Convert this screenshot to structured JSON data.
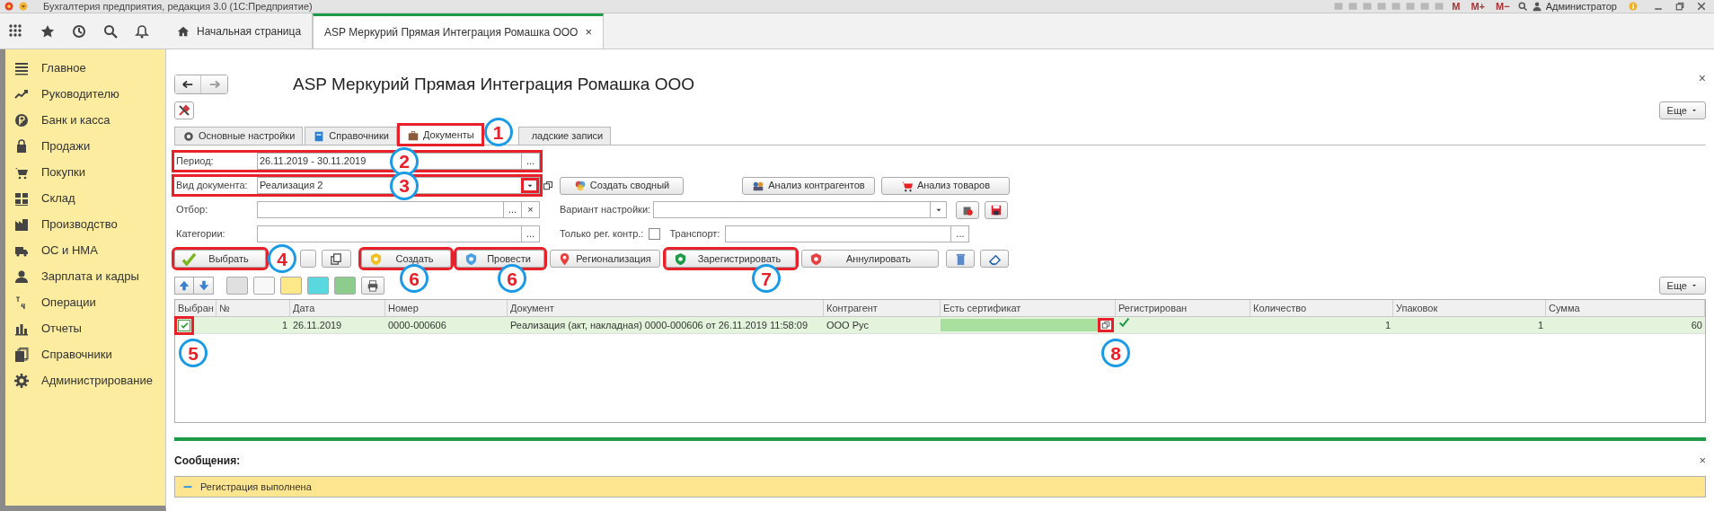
{
  "window": {
    "title": "Бухгалтерия предприятия, редакция 3.0  (1С:Предприятие)",
    "memory_buttons": [
      "M",
      "M+",
      "M−"
    ],
    "user": "Администратор"
  },
  "app_tabs": [
    {
      "label": "Начальная страница",
      "selected": false
    },
    {
      "label": "ASP Меркурий Прямая Интеграция Ромашка ООО",
      "selected": true,
      "close": "×"
    }
  ],
  "sidebar": {
    "items": [
      {
        "label": "Главное"
      },
      {
        "label": "Руководителю"
      },
      {
        "label": "Банк и касса"
      },
      {
        "label": "Продажи"
      },
      {
        "label": "Покупки"
      },
      {
        "label": "Склад"
      },
      {
        "label": "Производство"
      },
      {
        "label": "ОС и НМА"
      },
      {
        "label": "Зарплата и кадры"
      },
      {
        "label": "Операции"
      },
      {
        "label": "Отчеты"
      },
      {
        "label": "Справочники"
      },
      {
        "label": "Администрирование"
      }
    ]
  },
  "form": {
    "title": "ASP Меркурий Прямая Интеграция Ромашка ООО",
    "close": "×",
    "more_button": "Еще",
    "tabs": [
      {
        "label": "Основные настройки",
        "selected": false,
        "highlighted": false
      },
      {
        "label": "Справочники",
        "selected": false,
        "highlighted": false
      },
      {
        "label": "Документы",
        "selected": true,
        "highlighted": true,
        "callout": "1"
      },
      {
        "label": "ладские записи",
        "selected": false,
        "highlighted": false
      }
    ],
    "fields": [
      {
        "label": "Период:",
        "value": "26.11.2019 - 30.11.2019",
        "highlighted": true,
        "callout": "2",
        "buttons": [
          {
            "kind": "text",
            "text": "..."
          }
        ]
      },
      {
        "label": "Вид документа:",
        "value": "Реализация 2",
        "highlighted": true,
        "callout": "3",
        "buttons": [
          {
            "kind": "dropdown",
            "highlighted": true
          },
          {
            "kind": "open"
          }
        ]
      },
      {
        "label": "Отбор:",
        "highlighted": false,
        "buttons": [
          {
            "kind": "text",
            "text": "..."
          },
          {
            "kind": "text",
            "text": "×"
          }
        ]
      },
      {
        "label": "Категории:",
        "highlighted": false,
        "buttons": [
          {
            "kind": "text",
            "text": "..."
          }
        ]
      }
    ],
    "report_buttons": [
      "Создать сводный",
      "Анализ контрагентов",
      "Анализ товаров"
    ],
    "settings_variant": {
      "label": "Вариант настройки:"
    },
    "only_registered": {
      "label": "Только рег. контр.:",
      "checked": false
    },
    "transport": {
      "label": "Транспорт:",
      "button": "..."
    },
    "actions": [
      {
        "kind": "select",
        "label": "Выбрать",
        "highlighted": true,
        "callout": "4"
      },
      {
        "kind": "blank",
        "highlighted": false
      },
      {
        "kind": "copy",
        "highlighted": false
      },
      {
        "kind": "create",
        "label": "Создать",
        "highlighted": true,
        "callout": "6"
      },
      {
        "kind": "post",
        "label": "Провести",
        "highlighted": true,
        "callout": "6"
      },
      {
        "kind": "region",
        "label": "Регионализация",
        "highlighted": false
      },
      {
        "kind": "register",
        "label": "Зарегистрировать",
        "highlighted": true,
        "callout": "7"
      },
      {
        "kind": "cancel",
        "label": "Аннулировать",
        "highlighted": false
      },
      {
        "kind": "trash",
        "highlighted": false
      },
      {
        "kind": "eraser",
        "highlighted": false
      }
    ],
    "table_more_button": "Еще",
    "table": {
      "columns": [
        "Выбран",
        "№",
        "Дата",
        "Номер",
        "Документ",
        "Контрагент",
        "Есть сертификат",
        "Регистрирован",
        "Количество",
        "Упаковок",
        "Сумма"
      ],
      "rows": [
        {
          "selected": true,
          "highlighted": true,
          "callout": "5",
          "number": "1",
          "date": "26.11.2019",
          "doc_number": "0000-000606",
          "document": "Реализация (акт, накладная) 0000-000606 от 26.11.2019 11:58:09",
          "counterparty": "ООО Рус",
          "has_certificate": true,
          "registered": true,
          "open_highlighted": true,
          "open_callout": "8",
          "quantity": "1",
          "packages": "1",
          "sum": "60"
        }
      ]
    }
  },
  "messages": {
    "title": "Сообщения:",
    "close": "×",
    "items": [
      "Регистрация выполнена"
    ]
  }
}
